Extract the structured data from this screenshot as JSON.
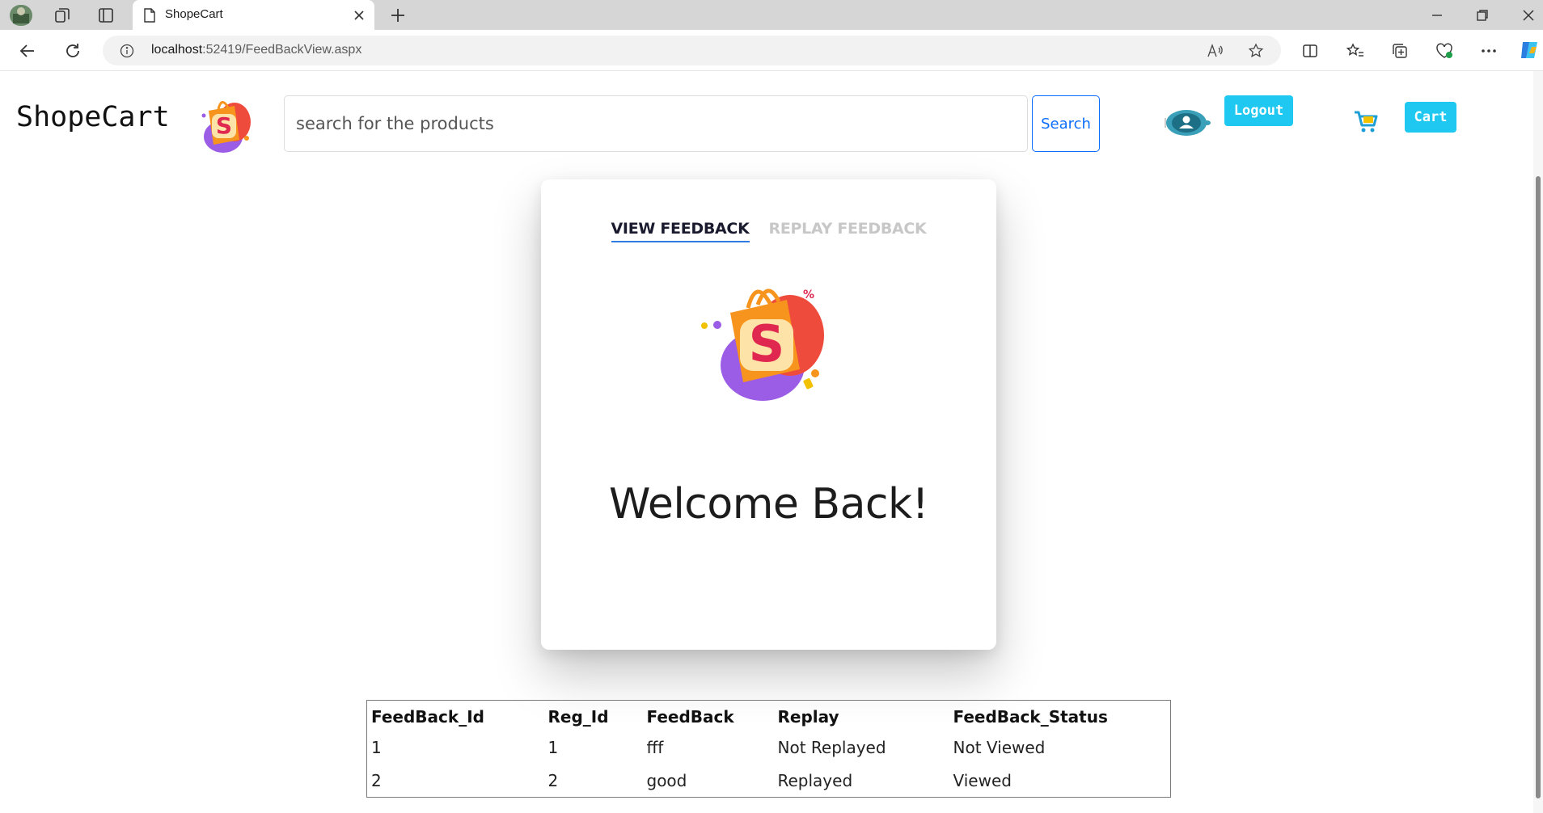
{
  "browser": {
    "tab_title": "ShopeCart",
    "url_host": "localhost",
    "url_path": ":52419/FeedBackView.aspx"
  },
  "header": {
    "brand": "ShopeCart",
    "search_placeholder": "search for the products",
    "search_label": "Search",
    "logout_label": "Logout",
    "cart_label": "Cart"
  },
  "card": {
    "tabs": [
      {
        "label": "VIEW FEEDBACK",
        "active": true
      },
      {
        "label": "REPLAY FEEDBACK",
        "active": false
      }
    ],
    "welcome": "Welcome Back!"
  },
  "table": {
    "headers": [
      "FeedBack_Id",
      "Reg_Id",
      "FeedBack",
      "Replay",
      "FeedBack_Status"
    ],
    "rows": [
      [
        "1",
        "1",
        "fff",
        "Not Replayed",
        "Not Viewed"
      ],
      [
        "2",
        "2",
        "good",
        "Replayed",
        "Viewed"
      ]
    ]
  },
  "colors": {
    "accent": "#1ec8f0",
    "primary": "#0d6efd",
    "tab_underline": "#2f7de1"
  }
}
